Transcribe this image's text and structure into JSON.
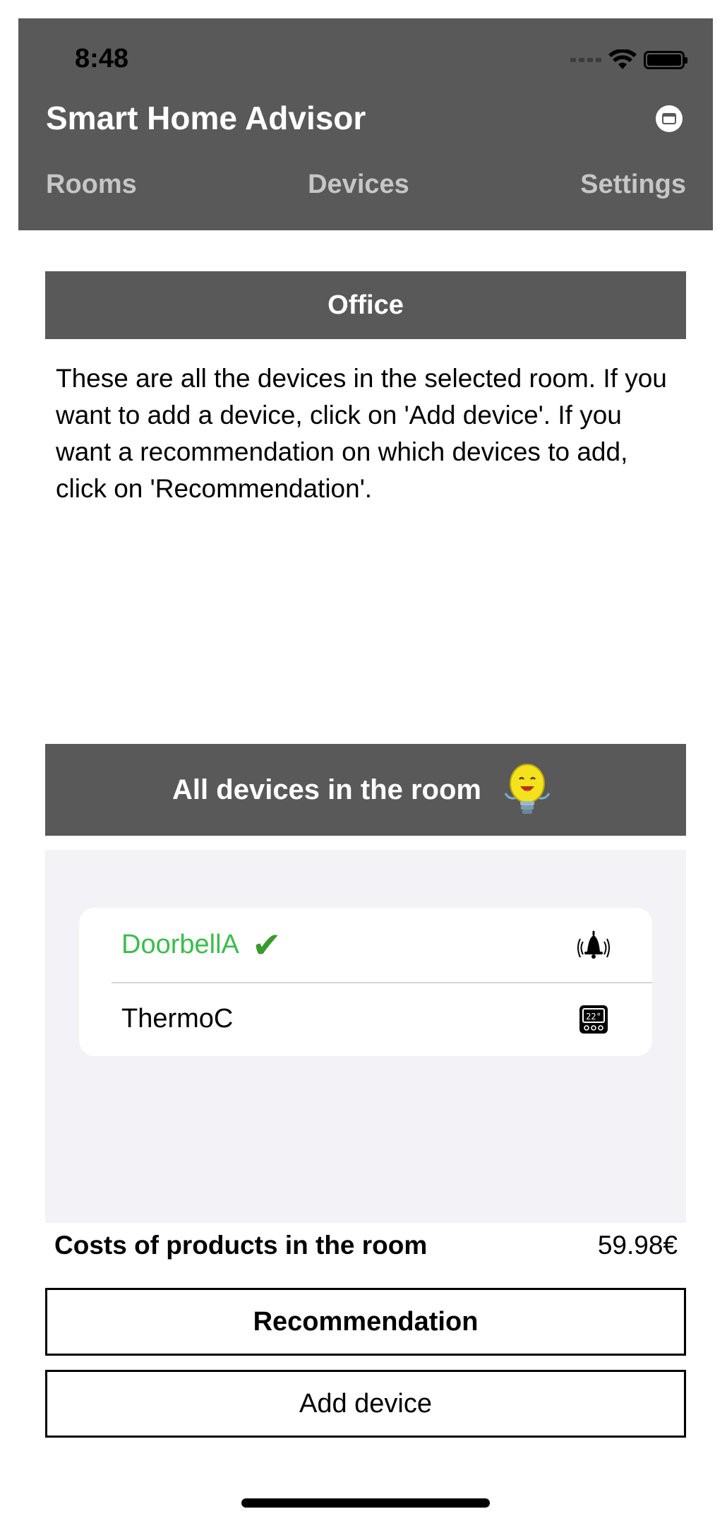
{
  "status_bar": {
    "time": "8:48"
  },
  "header": {
    "title": "Smart Home Advisor",
    "tabs": [
      "Rooms",
      "Devices",
      "Settings"
    ]
  },
  "room": {
    "name": "Office",
    "description": "These are all the devices in the selected room. If you want to add a device, click on 'Add device'. If you want a recommendation on which devices to add, click on 'Recommendation'."
  },
  "devices_section": {
    "title": "All devices in the room"
  },
  "devices": [
    {
      "name": "DoorbellA",
      "selected": true,
      "icon": "doorbell-icon"
    },
    {
      "name": "ThermoC",
      "selected": false,
      "icon": "thermostat-icon"
    }
  ],
  "costs": {
    "label": "Costs of products in the room",
    "value": "59.98€"
  },
  "buttons": {
    "recommendation": "Recommendation",
    "add_device": "Add device"
  },
  "colors": {
    "bar": "#595959",
    "selected": "#3cbc4e",
    "list_bg": "#f2f2f7"
  }
}
